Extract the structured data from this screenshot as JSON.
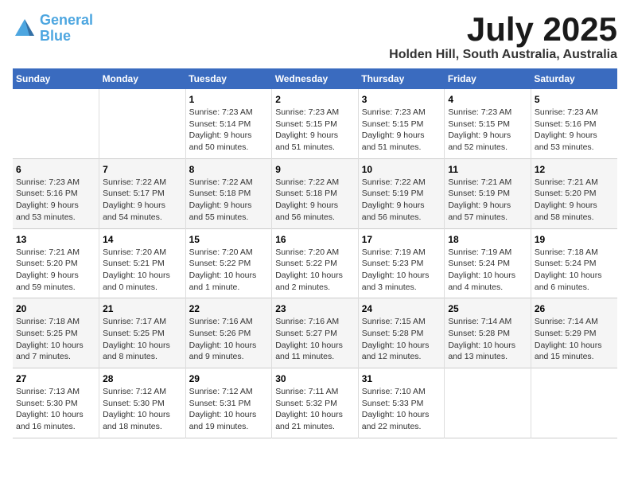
{
  "header": {
    "logo_line1": "General",
    "logo_line2": "Blue",
    "month": "July 2025",
    "location": "Holden Hill, South Australia, Australia"
  },
  "weekdays": [
    "Sunday",
    "Monday",
    "Tuesday",
    "Wednesday",
    "Thursday",
    "Friday",
    "Saturday"
  ],
  "weeks": [
    [
      {
        "day": "",
        "info": ""
      },
      {
        "day": "",
        "info": ""
      },
      {
        "day": "1",
        "info": "Sunrise: 7:23 AM\nSunset: 5:14 PM\nDaylight: 9 hours\nand 50 minutes."
      },
      {
        "day": "2",
        "info": "Sunrise: 7:23 AM\nSunset: 5:15 PM\nDaylight: 9 hours\nand 51 minutes."
      },
      {
        "day": "3",
        "info": "Sunrise: 7:23 AM\nSunset: 5:15 PM\nDaylight: 9 hours\nand 51 minutes."
      },
      {
        "day": "4",
        "info": "Sunrise: 7:23 AM\nSunset: 5:15 PM\nDaylight: 9 hours\nand 52 minutes."
      },
      {
        "day": "5",
        "info": "Sunrise: 7:23 AM\nSunset: 5:16 PM\nDaylight: 9 hours\nand 53 minutes."
      }
    ],
    [
      {
        "day": "6",
        "info": "Sunrise: 7:23 AM\nSunset: 5:16 PM\nDaylight: 9 hours\nand 53 minutes."
      },
      {
        "day": "7",
        "info": "Sunrise: 7:22 AM\nSunset: 5:17 PM\nDaylight: 9 hours\nand 54 minutes."
      },
      {
        "day": "8",
        "info": "Sunrise: 7:22 AM\nSunset: 5:18 PM\nDaylight: 9 hours\nand 55 minutes."
      },
      {
        "day": "9",
        "info": "Sunrise: 7:22 AM\nSunset: 5:18 PM\nDaylight: 9 hours\nand 56 minutes."
      },
      {
        "day": "10",
        "info": "Sunrise: 7:22 AM\nSunset: 5:19 PM\nDaylight: 9 hours\nand 56 minutes."
      },
      {
        "day": "11",
        "info": "Sunrise: 7:21 AM\nSunset: 5:19 PM\nDaylight: 9 hours\nand 57 minutes."
      },
      {
        "day": "12",
        "info": "Sunrise: 7:21 AM\nSunset: 5:20 PM\nDaylight: 9 hours\nand 58 minutes."
      }
    ],
    [
      {
        "day": "13",
        "info": "Sunrise: 7:21 AM\nSunset: 5:20 PM\nDaylight: 9 hours\nand 59 minutes."
      },
      {
        "day": "14",
        "info": "Sunrise: 7:20 AM\nSunset: 5:21 PM\nDaylight: 10 hours\nand 0 minutes."
      },
      {
        "day": "15",
        "info": "Sunrise: 7:20 AM\nSunset: 5:22 PM\nDaylight: 10 hours\nand 1 minute."
      },
      {
        "day": "16",
        "info": "Sunrise: 7:20 AM\nSunset: 5:22 PM\nDaylight: 10 hours\nand 2 minutes."
      },
      {
        "day": "17",
        "info": "Sunrise: 7:19 AM\nSunset: 5:23 PM\nDaylight: 10 hours\nand 3 minutes."
      },
      {
        "day": "18",
        "info": "Sunrise: 7:19 AM\nSunset: 5:24 PM\nDaylight: 10 hours\nand 4 minutes."
      },
      {
        "day": "19",
        "info": "Sunrise: 7:18 AM\nSunset: 5:24 PM\nDaylight: 10 hours\nand 6 minutes."
      }
    ],
    [
      {
        "day": "20",
        "info": "Sunrise: 7:18 AM\nSunset: 5:25 PM\nDaylight: 10 hours\nand 7 minutes."
      },
      {
        "day": "21",
        "info": "Sunrise: 7:17 AM\nSunset: 5:25 PM\nDaylight: 10 hours\nand 8 minutes."
      },
      {
        "day": "22",
        "info": "Sunrise: 7:16 AM\nSunset: 5:26 PM\nDaylight: 10 hours\nand 9 minutes."
      },
      {
        "day": "23",
        "info": "Sunrise: 7:16 AM\nSunset: 5:27 PM\nDaylight: 10 hours\nand 11 minutes."
      },
      {
        "day": "24",
        "info": "Sunrise: 7:15 AM\nSunset: 5:28 PM\nDaylight: 10 hours\nand 12 minutes."
      },
      {
        "day": "25",
        "info": "Sunrise: 7:14 AM\nSunset: 5:28 PM\nDaylight: 10 hours\nand 13 minutes."
      },
      {
        "day": "26",
        "info": "Sunrise: 7:14 AM\nSunset: 5:29 PM\nDaylight: 10 hours\nand 15 minutes."
      }
    ],
    [
      {
        "day": "27",
        "info": "Sunrise: 7:13 AM\nSunset: 5:30 PM\nDaylight: 10 hours\nand 16 minutes."
      },
      {
        "day": "28",
        "info": "Sunrise: 7:12 AM\nSunset: 5:30 PM\nDaylight: 10 hours\nand 18 minutes."
      },
      {
        "day": "29",
        "info": "Sunrise: 7:12 AM\nSunset: 5:31 PM\nDaylight: 10 hours\nand 19 minutes."
      },
      {
        "day": "30",
        "info": "Sunrise: 7:11 AM\nSunset: 5:32 PM\nDaylight: 10 hours\nand 21 minutes."
      },
      {
        "day": "31",
        "info": "Sunrise: 7:10 AM\nSunset: 5:33 PM\nDaylight: 10 hours\nand 22 minutes."
      },
      {
        "day": "",
        "info": ""
      },
      {
        "day": "",
        "info": ""
      }
    ]
  ]
}
